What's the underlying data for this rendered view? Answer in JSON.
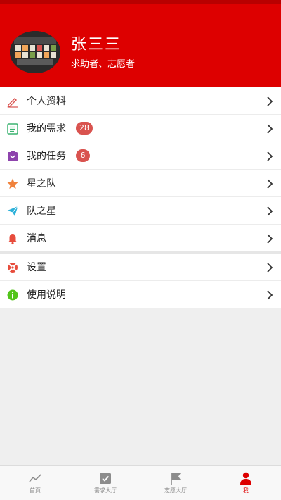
{
  "profile": {
    "name": "张三三",
    "roles": "求助者、志愿者"
  },
  "menu": {
    "group1": [
      {
        "label": "个人资料",
        "icon": "edit-icon",
        "badge": null
      },
      {
        "label": "我的需求",
        "icon": "list-icon",
        "badge": "28"
      },
      {
        "label": "我的任务",
        "icon": "task-icon",
        "badge": "6"
      },
      {
        "label": "星之队",
        "icon": "star-icon",
        "badge": null
      },
      {
        "label": "队之星",
        "icon": "send-icon",
        "badge": null
      },
      {
        "label": "消息",
        "icon": "bell-icon",
        "badge": null
      }
    ],
    "group2": [
      {
        "label": "设置",
        "icon": "settings-icon",
        "badge": null
      },
      {
        "label": "使用说明",
        "icon": "info-icon",
        "badge": null
      }
    ]
  },
  "tabbar": [
    {
      "label": "首页",
      "icon": "trend-icon",
      "active": false
    },
    {
      "label": "需求大厅",
      "icon": "calendar-check-icon",
      "active": false
    },
    {
      "label": "志愿大厅",
      "icon": "flag-icon",
      "active": false
    },
    {
      "label": "我",
      "icon": "person-icon",
      "active": true
    }
  ],
  "colors": {
    "brand_red": "#dd0000",
    "badge_red": "#d9534f",
    "edit_icon": "#d9534f",
    "list_icon": "#3cb371",
    "task_icon": "#8e44ad",
    "star_icon": "#f0823c",
    "send_icon": "#2bb0d9",
    "bell_icon": "#e74c3c",
    "info_icon": "#52c41a"
  }
}
